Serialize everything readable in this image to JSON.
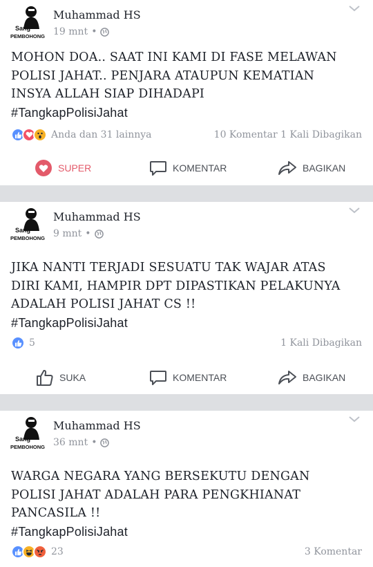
{
  "posts": [
    {
      "author": "Muhammad HS",
      "avatar_text_1": "Sang",
      "avatar_text_2": "PEMBOHONG",
      "time": "19 mnt",
      "dot": "•",
      "lines": [
        "MOHON DOA.. SAAT INI KAMI DI FASE  MELAWAN",
        "POLISI JAHAT.. PENJARA ATAUPUN KEMATIAN",
        "INSYA ALLAH SIAP DIHADAPI"
      ],
      "hashtag": "#TangkapPolisiJahat",
      "reactions": [
        "like",
        "love",
        "wow"
      ],
      "reaction_text": "Anda dan 31 lainnya",
      "stats_right": "10 Komentar  1 Kali Dibagikan",
      "actions": {
        "react": "SUPER",
        "comment": "KOMENTAR",
        "share": "BAGIKAN"
      }
    },
    {
      "author": "Muhammad HS",
      "avatar_text_1": "Sang",
      "avatar_text_2": "PEMBOHONG",
      "time": "9 mnt",
      "dot": "•",
      "lines": [
        "JIKA NANTI TERJADI SESUATU TAK WAJAR ATAS",
        "DIRI KAMI, HAMPIR DPT DIPASTIKAN PELAKUNYA",
        "ADALAH POLISI JAHAT CS !!"
      ],
      "hashtag": "#TangkapPolisiJahat",
      "reactions": [
        "like"
      ],
      "reaction_text": "5",
      "stats_right": "1 Kali Dibagikan",
      "actions": {
        "react": "SUKA",
        "comment": "KOMENTAR",
        "share": "BAGIKAN"
      }
    },
    {
      "author": "Muhammad HS",
      "avatar_text_1": "Sang",
      "avatar_text_2": "PEMBOHONG",
      "time": "36 mnt",
      "dot": "•",
      "lines": [
        "WARGA NEGARA YANG BERSEKUTU DENGAN",
        "POLISI JAHAT ADALAH PARA PENGKHIANAT",
        "PANCASILA !!"
      ],
      "hashtag": "#TangkapPolisiJahat",
      "reactions": [
        "like",
        "haha",
        "angry"
      ],
      "reaction_text": "23",
      "stats_right": "3 Komentar"
    }
  ],
  "colors": {
    "like": "#5890ff",
    "love": "#f25268",
    "wow": "#f7b125",
    "super_active": "#e35a6a",
    "meta": "#90949c",
    "separator": "#dddfe2"
  }
}
